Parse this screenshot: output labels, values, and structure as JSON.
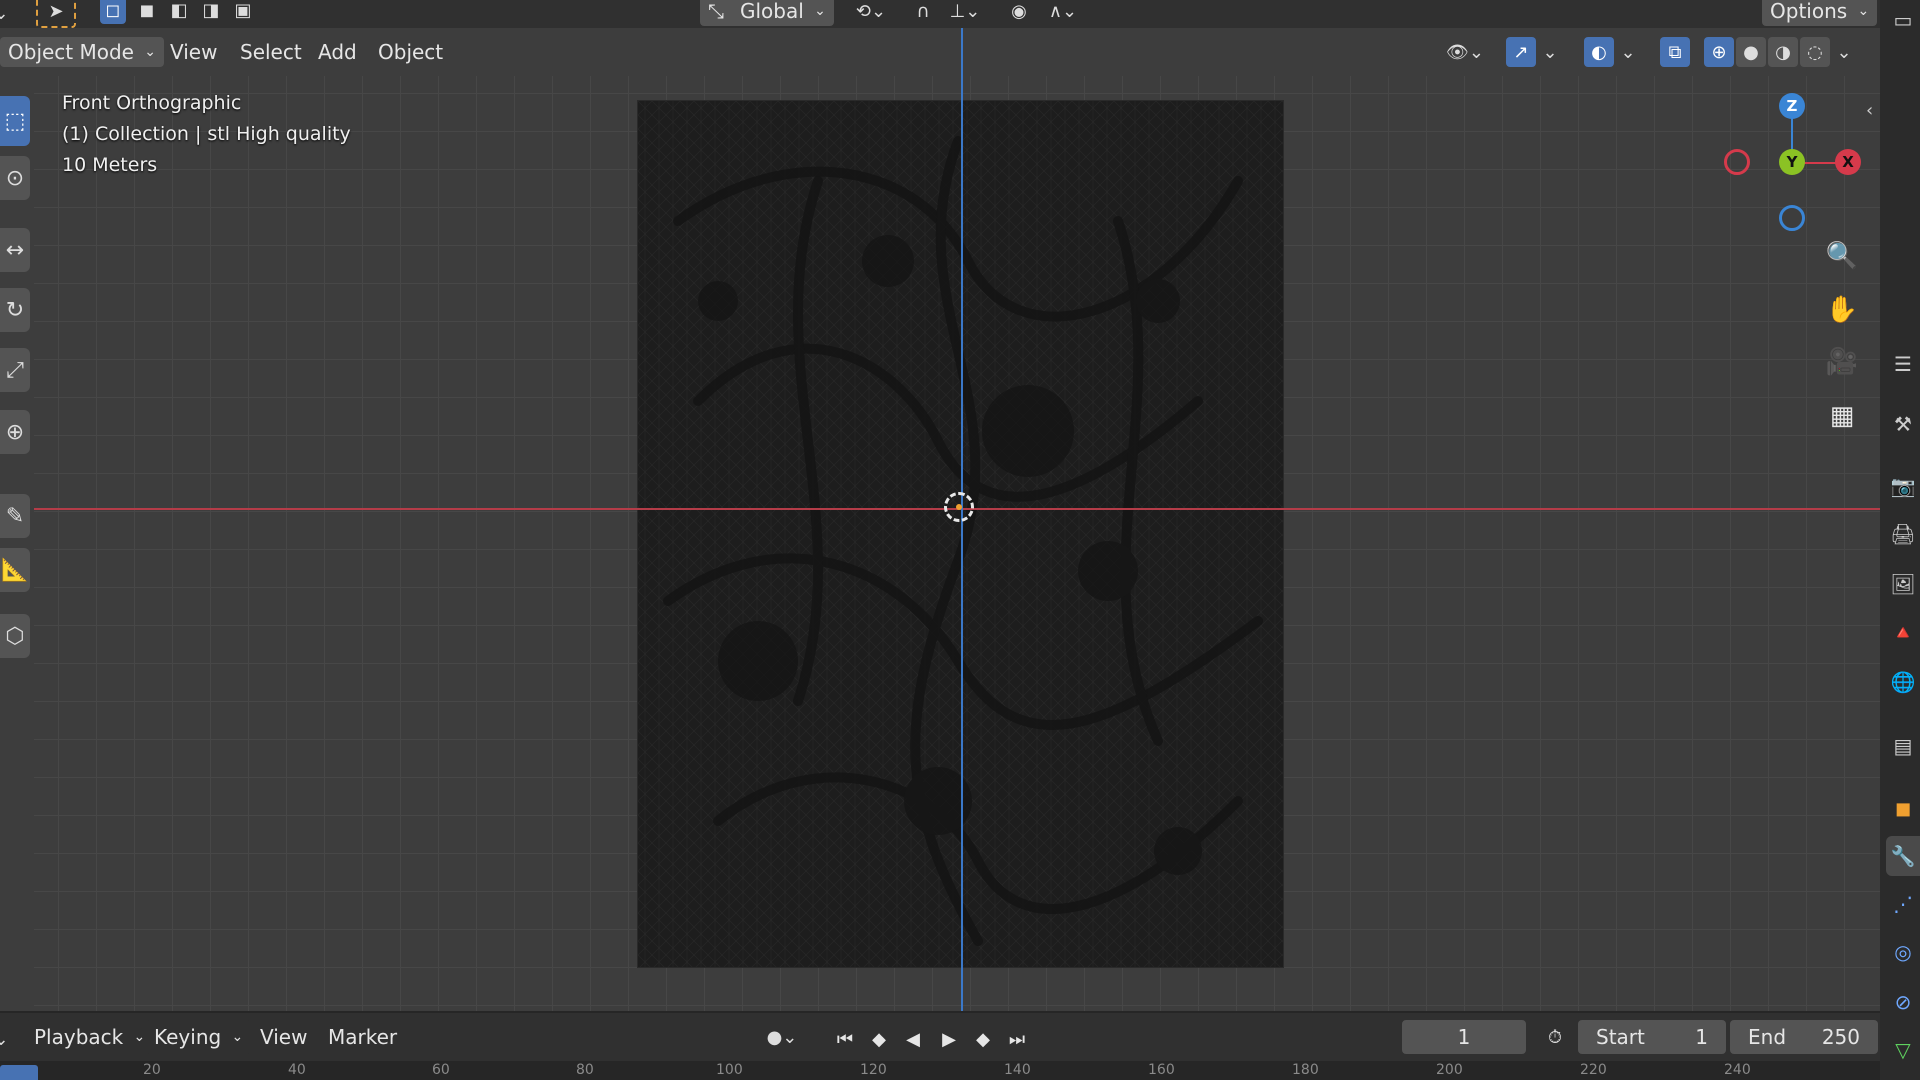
{
  "tool_header": {
    "orientation_label": "Global",
    "options_label": "Options"
  },
  "view_header": {
    "mode_label": "Object Mode",
    "menus": [
      "View",
      "Select",
      "Add",
      "Object"
    ]
  },
  "viewport_overlay": {
    "view_name": "Front Orthographic",
    "collection": "(1) Collection | stl High quality",
    "scale": "10 Meters"
  },
  "gizmo": {
    "z_label": "Z",
    "y_label": "Y",
    "x_label": "X",
    "colors": {
      "x": "#d53a4b",
      "y": "#8bc224",
      "z": "#3a85d5"
    }
  },
  "timeline": {
    "menus": [
      "Playback",
      "Keying",
      "View",
      "Marker"
    ],
    "current_frame": "1",
    "start_label": "Start",
    "start_value": "1",
    "end_label": "End",
    "end_value": "250",
    "ruler_ticks": [
      "20",
      "40",
      "60",
      "80",
      "100",
      "120",
      "140",
      "160",
      "180",
      "200",
      "220",
      "240"
    ]
  },
  "colors": {
    "accent": "#4772b3",
    "x_axis": "#b43c48",
    "y_axis": "#3b78c8"
  }
}
